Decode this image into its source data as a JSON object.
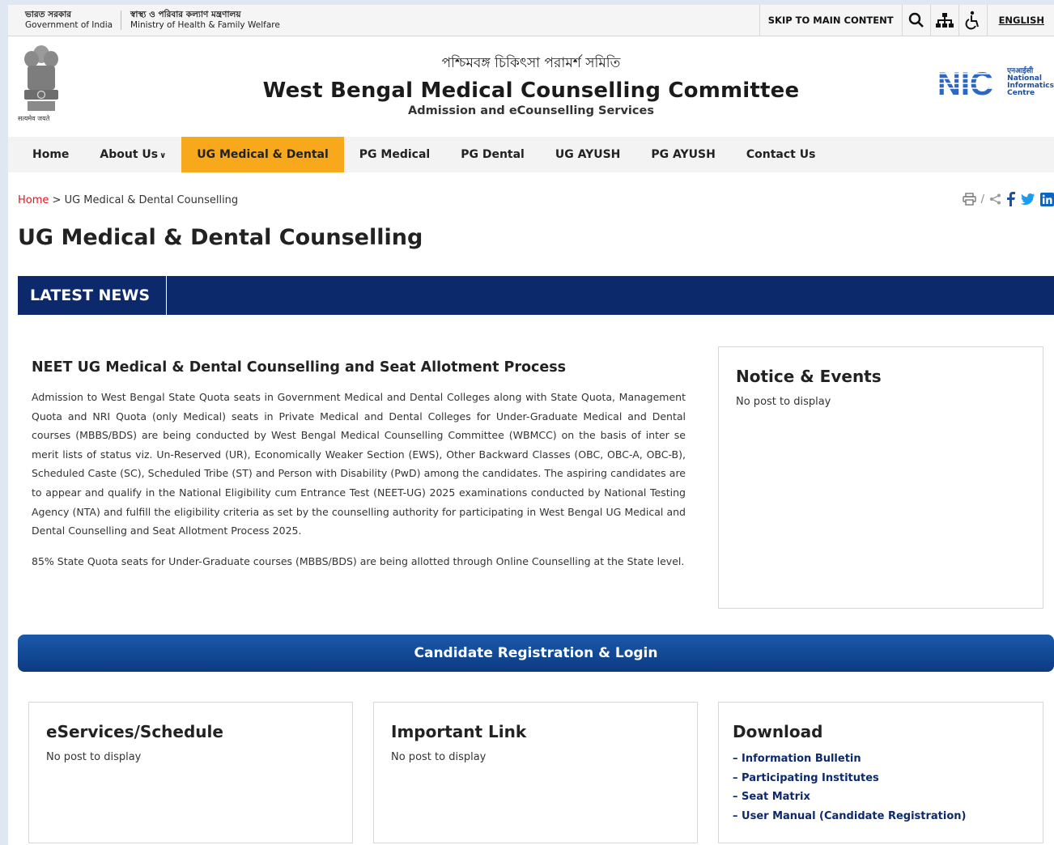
{
  "govbar": {
    "gov_hi": "ভারত সরকার",
    "gov_en": "Government of India",
    "min_hi": "স্বাস্থ্য ও পরিবার কল্যাণ মন্ত্রণালয়",
    "min_en": "Ministry of Health & Family Welfare",
    "skip": "SKIP TO MAIN CONTENT",
    "language": "ENGLISH"
  },
  "header": {
    "emblem_caption": "सत्यमेव जयते",
    "title_bn": "পশ্চিমবঙ্গ চিকিৎসা পরামর্শ সমিতি",
    "title_en": "West Bengal Medical Counselling Committee",
    "subtitle": "Admission and eCounselling Services",
    "nic_logo": "NIC",
    "nic_hi": "एनआईसी",
    "nic_en1": "National",
    "nic_en2": "Informatics",
    "nic_en3": "Centre"
  },
  "nav": {
    "items": [
      "Home",
      "About Us",
      "UG Medical & Dental",
      "PG Medical",
      "PG Dental",
      "UG AYUSH",
      "PG AYUSH",
      "Contact Us"
    ],
    "active": "UG Medical & Dental"
  },
  "breadcrumb": {
    "home": "Home",
    "sep": ">",
    "current": "UG Medical & Dental Counselling"
  },
  "page_title": "UG Medical & Dental Counselling",
  "news_label": "LATEST NEWS",
  "article": {
    "title": "NEET UG Medical & Dental Counselling and Seat Allotment Process",
    "p1": "Admission to West Bengal State Quota seats in Government Medical and Dental Colleges along with State Quota, Management Quota and NRI Quota (only Medical) seats in Private Medical and Dental Colleges for Under-Graduate Medical and Dental courses (MBBS/BDS) are being conducted by West Bengal Medical Counselling Committee (WBMCC) on the basis of inter se merit lists of status viz. Un-Reserved (UR), Economically Weaker Section (EWS), Other Backward Classes (OBC, OBC-A, OBC-B), Scheduled Caste (SC), Scheduled Tribe (ST) and Person with Disability (PwD) among the candidates. The aspiring candidates are to appear and qualify in the National Eligibility cum Entrance Test (NEET-UG) 2025 examinations conducted by National Testing Agency (NTA) and fulfill the eligibility criteria as set by the counselling authority for participating in West Bengal UG Medical and Dental Counselling and Seat Allotment Process 2025.",
    "p2": "85% State Quota seats for Under-Graduate courses (MBBS/BDS) are being allotted through Online Counselling at the State level."
  },
  "notice": {
    "title": "Notice & Events",
    "empty": "No post to display"
  },
  "registration": {
    "label": "Candidate Registration & Login"
  },
  "eservices": {
    "title": "eServices/Schedule",
    "empty": "No post to display"
  },
  "important": {
    "title": "Important Link",
    "empty": "No post to display"
  },
  "download": {
    "title": "Download",
    "items": [
      "– Information Bulletin",
      "– Participating Institutes",
      "– Seat Matrix",
      "– User Manual (Candidate Registration)"
    ]
  },
  "share": {
    "sep": "/"
  },
  "colors": {
    "navy": "#0c2a6b",
    "accent": "#f7a81b",
    "link_red": "#e4151f"
  }
}
